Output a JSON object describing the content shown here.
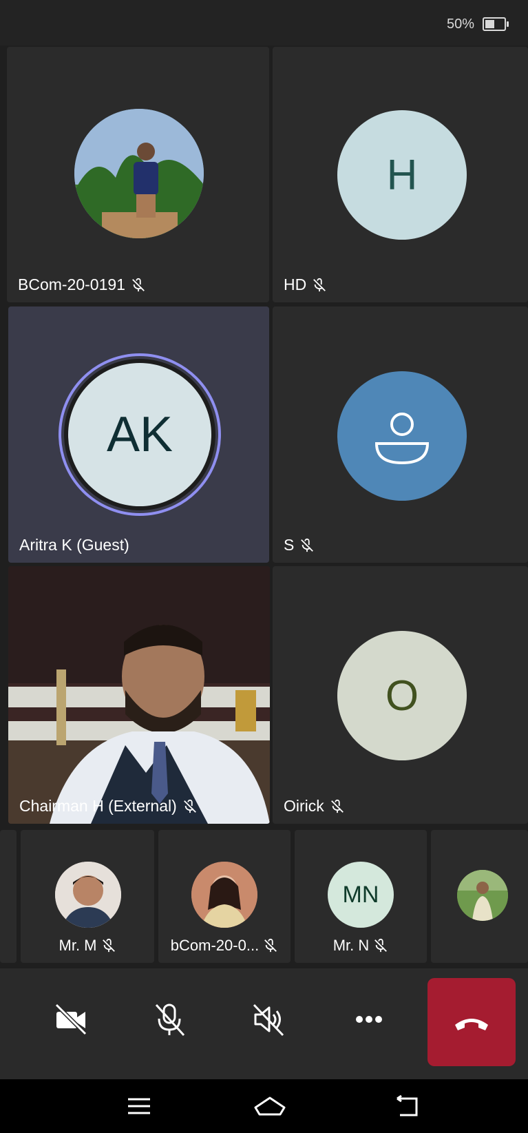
{
  "status_bar": {
    "battery_text": "50%",
    "battery_level": 0.5
  },
  "tiles": [
    {
      "name": "BCom-20-0191",
      "muted": true,
      "type": "photo"
    },
    {
      "name": "HD",
      "muted": true,
      "initial": "H",
      "avatar_color": "#c6dce0",
      "text_color": "#22544f"
    },
    {
      "name": "Aritra K (Guest)",
      "muted": false,
      "initial": "AK",
      "avatar_color": "#d6e3e6",
      "text_color": "#0f2e33",
      "ring_color": "#8f8ff0",
      "speaking": true
    },
    {
      "name": "S",
      "muted": true,
      "type": "generic-user",
      "avatar_color": "#4f87b7"
    },
    {
      "name": "Chairman H (External)",
      "muted": true,
      "type": "video"
    },
    {
      "name": "Oirick",
      "muted": true,
      "initial": "O",
      "avatar_color": "#d4d9cc",
      "text_color": "#41511f"
    }
  ],
  "strip": [
    {
      "name": "Mr. M",
      "muted": true,
      "type": "photo"
    },
    {
      "name": "bCom-20-0...",
      "muted": true,
      "type": "photo"
    },
    {
      "name": "Mr. N",
      "muted": true,
      "initial": "MN",
      "avatar_color": "#d4e8dc",
      "text_color": "#0f3b2a"
    },
    {
      "name": "",
      "muted": false,
      "type": "photo"
    }
  ],
  "controls": {
    "camera": "camera-off-icon",
    "mic": "mic-off-icon",
    "speaker": "speaker-off-icon",
    "more": "more-icon",
    "end_call_color": "#a51c30"
  }
}
